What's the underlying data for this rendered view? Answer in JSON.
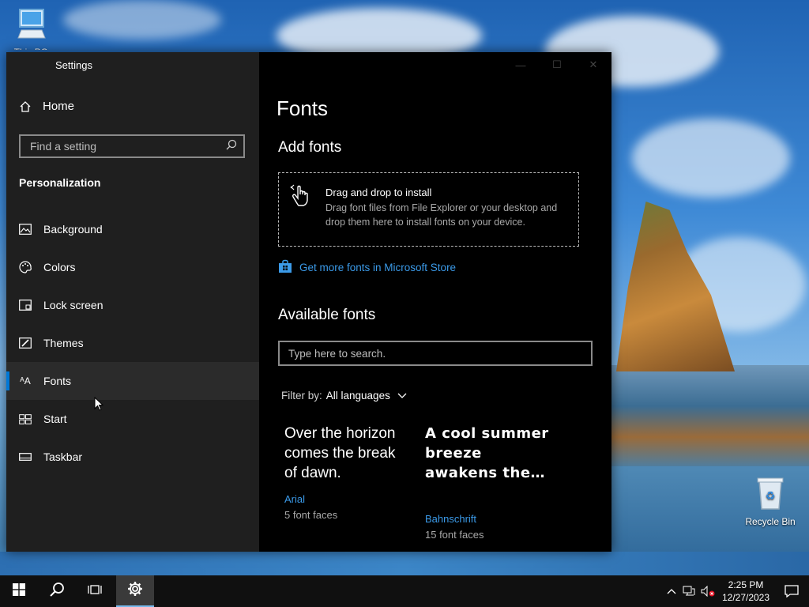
{
  "desktop": {
    "icons": [
      {
        "label": "This PC"
      },
      {
        "label": "Recycle Bin"
      }
    ]
  },
  "window": {
    "title": "Settings",
    "controls": {
      "minimize": "—",
      "maximize": "☐",
      "close": "✕"
    }
  },
  "sidebar": {
    "home_label": "Home",
    "search_placeholder": "Find a setting",
    "section_heading": "Personalization",
    "items": [
      {
        "label": "Background",
        "icon": "image-icon"
      },
      {
        "label": "Colors",
        "icon": "palette-icon"
      },
      {
        "label": "Lock screen",
        "icon": "lock-screen-icon"
      },
      {
        "label": "Themes",
        "icon": "themes-icon"
      },
      {
        "label": "Fonts",
        "icon": "fonts-icon",
        "active": true
      },
      {
        "label": "Start",
        "icon": "start-icon"
      },
      {
        "label": "Taskbar",
        "icon": "taskbar-icon"
      }
    ]
  },
  "content": {
    "page_title": "Fonts",
    "add_fonts_heading": "Add fonts",
    "drop_zone": {
      "title": "Drag and drop to install",
      "description": "Drag font files from File Explorer or your desktop and drop them here to install fonts on your device."
    },
    "store_link": "Get more fonts in Microsoft Store",
    "available_heading": "Available fonts",
    "font_search_placeholder": "Type here to search.",
    "filter": {
      "label": "Filter by:",
      "value": "All languages"
    },
    "fonts": [
      {
        "sample": "Over the horizon comes the break of dawn.",
        "name": "Arial",
        "faces": "5 font faces"
      },
      {
        "sample": "A cool summer breeze awakens the…",
        "name": "Bahnschrift",
        "faces": "15 font faces"
      }
    ]
  },
  "taskbar": {
    "time": "2:25 PM",
    "date": "12/27/2023"
  },
  "colors": {
    "accent": "#0078d7",
    "link": "#3b9ae8",
    "sidebar_bg": "#1f1f1f",
    "content_bg": "#000000"
  }
}
